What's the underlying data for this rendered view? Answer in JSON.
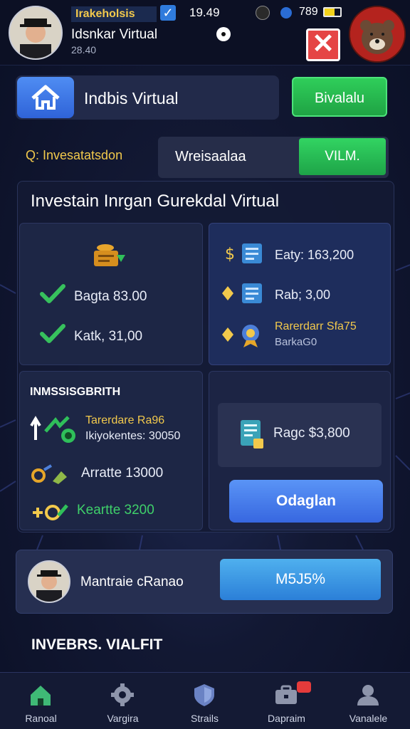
{
  "status_bar": {
    "user_title": "Irakeholsis",
    "clock": "19.49",
    "battery": "789",
    "user_name": "Idsnkar Virtual",
    "user_sub": "28.40"
  },
  "header": {
    "title": "Indbis Virtual",
    "action_label": "Bivalalu"
  },
  "selector": {
    "label": "Q: Invesatatsdon",
    "value": "Wreisaalaa",
    "button_label": "VILM."
  },
  "main": {
    "title": "Investain Inrgan Gurekdal Virtual",
    "top_left_items": [
      {
        "label": "Bagta 83.00"
      },
      {
        "label": "Katk, 31,00"
      }
    ],
    "top_right_items": [
      {
        "label": "Eaty: 163,200"
      },
      {
        "label": "Rab; 3,00"
      },
      {
        "label": "Rarerdarr Sfa75",
        "sub": "BarkaG0"
      }
    ],
    "secondary_title": "INMSSISGBRITH",
    "bottom_left_items": [
      {
        "label": "Tarerdare Ra96",
        "sub": "Ikiyokentes: 30050"
      },
      {
        "label": "Arratte 13000"
      },
      {
        "label": "Keartte 3200"
      }
    ],
    "price_label": "Ragc $3,800",
    "button_label": "Odaglan"
  },
  "profile": {
    "name": "Mantraie cRanao",
    "percent_label": "M5J5%"
  },
  "section_title": "INVEBRS. VIALFIT",
  "nav": [
    {
      "label": "Ranoal",
      "icon": "home-icon"
    },
    {
      "label": "Vargira",
      "icon": "gear-icon"
    },
    {
      "label": "Strails",
      "icon": "shield-icon"
    },
    {
      "label": "Dapraim",
      "icon": "briefcase-icon"
    },
    {
      "label": "Vanalele",
      "icon": "user-icon"
    }
  ],
  "colors": {
    "accent_green": "#2fce5a",
    "accent_blue": "#3767e0",
    "gold": "#f2c94c",
    "background": "#121833"
  }
}
